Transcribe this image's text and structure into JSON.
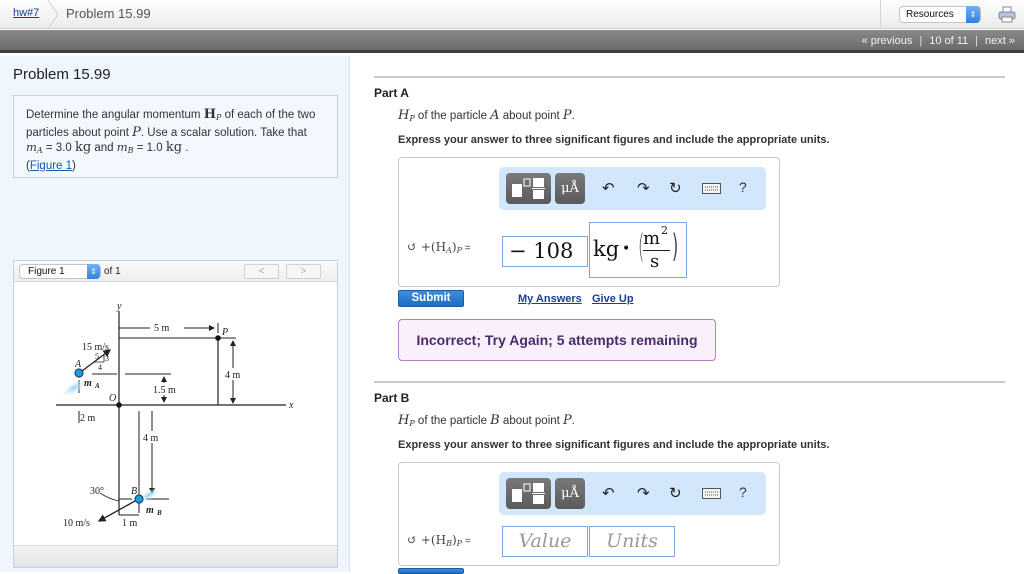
{
  "header": {
    "breadcrumb_link": "hw#7",
    "title": "Problem 15.99",
    "resources_select": "Resources",
    "print_icon": "printer-icon"
  },
  "nav": {
    "previous": "« previous",
    "position": "10 of 11",
    "next": "next »"
  },
  "problem": {
    "title": "Problem 15.99",
    "text_1": "Determine the angular momentum ",
    "H": "H",
    "P_sub": "P",
    "text_2": " of each of the two particles about point ",
    "P": "P",
    "text_3": ". Use a scalar solution. Take that ",
    "m": "m",
    "A_sub": "A",
    "mA_val": " = 3.0 ",
    "kg": "kg",
    "and": " and ",
    "B_sub": "B",
    "mB_val": " = 1.0 ",
    "end": " .",
    "figure_link_open": "(",
    "figure_link": "Figure 1",
    "figure_link_close": ")"
  },
  "figure": {
    "select_value": "Figure 1",
    "of_label": "of 1",
    "prev_label": "<",
    "next_label": ">",
    "labels": {
      "y": "y",
      "x": "x",
      "d5": "5 m",
      "P": "P",
      "v15": "15 m/s",
      "n5": "5",
      "n3": "3",
      "n4": "4",
      "A": "A",
      "mA": "m",
      "mA_sub": "A",
      "O": "O",
      "d4": "4 m",
      "d15": "1.5 m",
      "d2": "2 m",
      "d4b": "4 m",
      "ang": "30°",
      "B": "B",
      "mB": "m",
      "mB_sub": "B",
      "v10": "10 m/s",
      "d1": "1 m"
    }
  },
  "partA": {
    "label": "Part A",
    "q_H": "H",
    "q_Psub": "P",
    "q_text1": " of the particle ",
    "q_A": "A",
    "q_text2": " about point ",
    "q_P": "P",
    "q_end": ".",
    "instruction": "Express your answer to three significant figures and include the appropriate units.",
    "eq_label": "↺ +(H",
    "eq_sub": "A",
    "eq_close": ")",
    "eq_sub2": "P",
    "eq_eq": " =",
    "value": "− 108",
    "unit_kg": "kg",
    "unit_dot": "•",
    "unit_num": "m",
    "unit_exp": "2",
    "unit_den": "s",
    "submit": "Submit",
    "my_answers": "My Answers",
    "give_up": "Give Up",
    "feedback": "Incorrect; Try Again; 5 attempts remaining"
  },
  "partB": {
    "label": "Part B",
    "q_H": "H",
    "q_Psub": "P",
    "q_text1": " of the particle ",
    "q_B": "B",
    "q_text2": " about point ",
    "q_P": "P",
    "q_end": ".",
    "instruction": "Express your answer to three significant figures and include the appropriate units.",
    "eq_label": "↺ +(H",
    "eq_sub": "B",
    "eq_close": ")",
    "eq_sub2": "P",
    "eq_eq": " =",
    "value_placeholder": "Value",
    "units_placeholder": "Units"
  },
  "toolbar": {
    "units_label": "μÅ",
    "help_label": "?"
  }
}
